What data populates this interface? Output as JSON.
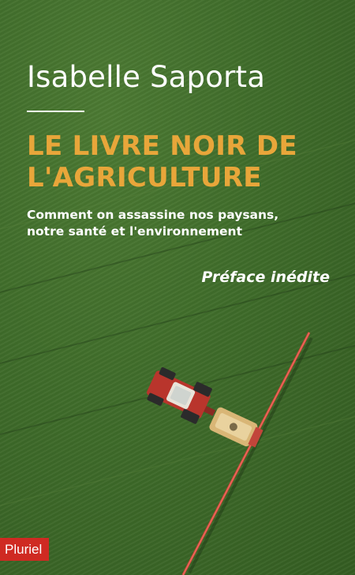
{
  "cover": {
    "author": "Isabelle Saporta",
    "title_lines": [
      "LE LIVRE NOIR DE",
      "L'AGRICULTURE"
    ],
    "subtitle_lines": [
      "Comment on assassine nos paysans,",
      "notre santé et l'environnement"
    ],
    "preface": "Préface inédite",
    "publisher": "Pluriel"
  },
  "colors": {
    "field_green": "#3f6a2a",
    "title_orange": "#e8a63a",
    "publisher_red": "#cf2a22",
    "sprayer_red": "#d9483c",
    "text_white": "#ffffff"
  }
}
